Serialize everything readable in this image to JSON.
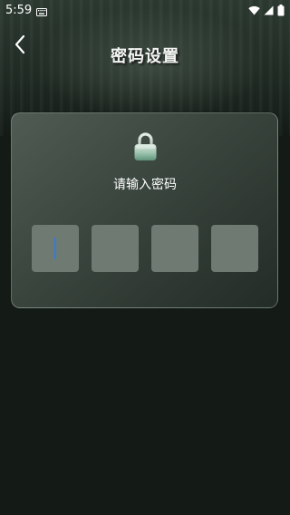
{
  "status_bar": {
    "time": "5:59",
    "icons": [
      "keyboard-icon",
      "wifi-icon",
      "signal-icon",
      "battery-icon"
    ]
  },
  "header": {
    "title": "密码设置",
    "back_icon": "chevron-left-icon"
  },
  "unlock": {
    "icon": "lock-icon",
    "prompt": "请输入密码",
    "pin_length": 4,
    "active_index": 0,
    "values": [
      "",
      "",
      "",
      ""
    ]
  },
  "colors": {
    "background": "#141b16",
    "card": "#3a453e",
    "pin_box": "#6f7b72",
    "cursor": "#2f7de1",
    "lock_accent": "#7fb39a"
  }
}
